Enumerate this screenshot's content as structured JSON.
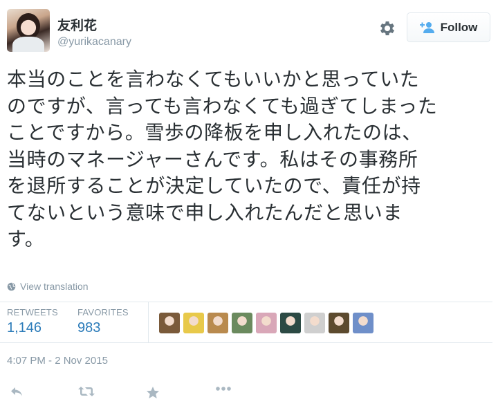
{
  "user": {
    "display_name": "友利花",
    "username": "@yurikacanary"
  },
  "header": {
    "follow_label": "Follow"
  },
  "tweet": {
    "lines": [
      "本当のことを言わなくてもいいかと思っていた",
      "のですが、言っても言わなくても過ぎてしまった",
      "ことですから。雪歩の降板を申し入れたのは、",
      "当時のマネージャーさんです。私はその事務所",
      "を退所することが決定していたので、責任が持",
      "てないという意味で申し入れたんだと思いま",
      "す。"
    ]
  },
  "translate_label": "View translation",
  "stats": {
    "retweets_label": "RETWEETS",
    "retweets_value": "1,146",
    "favorites_label": "FAVORITES",
    "favorites_value": "983"
  },
  "favoriter_avatar_colors": [
    "#7a5a3a",
    "#e8c94a",
    "#b98a4e",
    "#6b8a5e",
    "#d9a7b8",
    "#2c4a44",
    "#cfcfcf",
    "#5c4a2e",
    "#6f8fc9"
  ],
  "timestamp": "4:07 PM - 2 Nov 2015",
  "colors": {
    "text": "#292f33",
    "muted": "#8899a6",
    "link": "#2b7bb9",
    "follow_icon": "#55acee",
    "border": "#e1e8ed"
  },
  "icons": [
    "gear-icon",
    "follow-person-icon",
    "globe-icon",
    "reply-icon",
    "retweet-icon",
    "favorite-icon",
    "more-icon"
  ]
}
